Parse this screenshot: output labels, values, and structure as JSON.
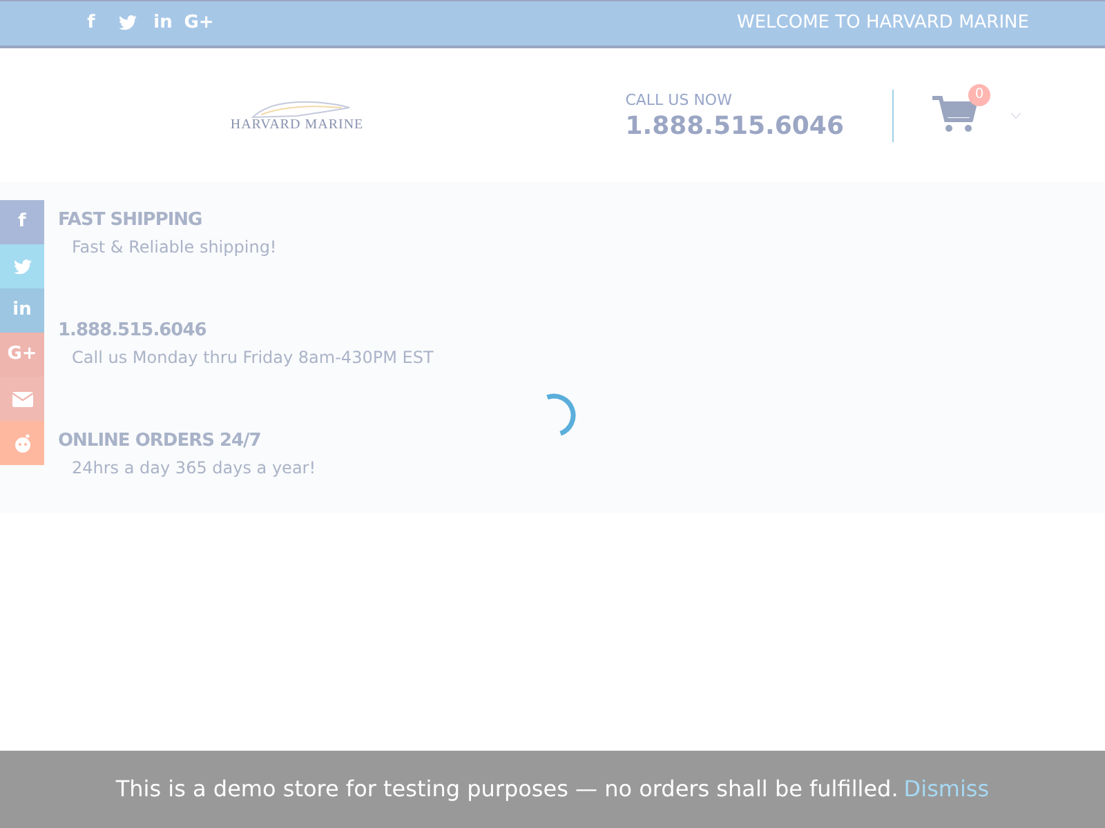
{
  "top_bar": {
    "social": [
      {
        "kind": "glyph",
        "text": "f"
      },
      {
        "kind": "twitter"
      },
      {
        "kind": "glyph",
        "text": "in"
      },
      {
        "kind": "glyph",
        "text": "G+"
      }
    ],
    "welcome": "WELCOME TO HARVARD MARINE"
  },
  "header": {
    "logo_text": "HARVARD MARINE",
    "call_label": "CALL US NOW",
    "phone": "1.888.515.6046",
    "cart_count": "0"
  },
  "share_bar": [
    {
      "kind": "glyph",
      "text": "f",
      "color": "#a9b8d8"
    },
    {
      "kind": "twitter",
      "color": "#a3dbf1"
    },
    {
      "kind": "glyph",
      "text": "in",
      "color": "#9cc6e2"
    },
    {
      "kind": "glyph",
      "text": "G+",
      "color": "#eeb4ae"
    },
    {
      "kind": "mail",
      "color": "#f0b9b2"
    },
    {
      "kind": "reddit",
      "color": "#ffb8a0"
    }
  ],
  "features": [
    {
      "title": "FAST SHIPPING",
      "text": "Fast & Reliable shipping!"
    },
    {
      "title": "1.888.515.6046",
      "text": "Call us Monday thru Friday 8am-430PM EST"
    },
    {
      "title": "ONLINE ORDERS 24/7",
      "text": "24hrs a day 365 days a year!"
    }
  ],
  "notice": {
    "text": "This is a demo store for testing purposes — no orders shall be fulfilled.",
    "link": "Dismiss"
  }
}
